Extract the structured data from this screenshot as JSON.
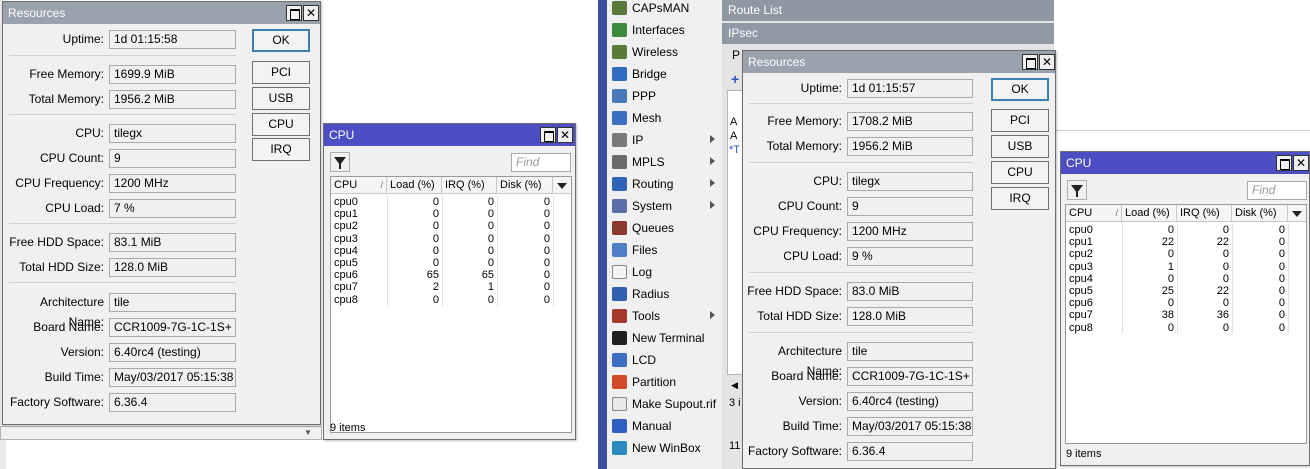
{
  "left": {
    "resources": {
      "title": "Resources",
      "fields": [
        {
          "label": "Uptime:",
          "value": "1d 01:15:58"
        },
        {
          "label": "Free Memory:",
          "value": "1699.9 MiB"
        },
        {
          "label": "Total Memory:",
          "value": "1956.2 MiB"
        },
        {
          "label": "CPU:",
          "value": "tilegx"
        },
        {
          "label": "CPU Count:",
          "value": "9"
        },
        {
          "label": "CPU Frequency:",
          "value": "1200 MHz"
        },
        {
          "label": "CPU Load:",
          "value": "7 %"
        },
        {
          "label": "Free HDD Space:",
          "value": "83.1 MiB"
        },
        {
          "label": "Total HDD Size:",
          "value": "128.0 MiB"
        },
        {
          "label": "Architecture Name:",
          "value": "tile"
        },
        {
          "label": "Board Name:",
          "value": "CCR1009-7G-1C-1S+"
        },
        {
          "label": "Version:",
          "value": "6.40rc4 (testing)"
        },
        {
          "label": "Build Time:",
          "value": "May/03/2017 05:15:38"
        },
        {
          "label": "Factory Software:",
          "value": "6.36.4"
        }
      ],
      "buttons": [
        "OK",
        "PCI",
        "USB",
        "CPU",
        "IRQ"
      ]
    },
    "cpu": {
      "title": "CPU",
      "find_placeholder": "Find",
      "columns": [
        "CPU",
        "Load (%)",
        "IRQ (%)",
        "Disk (%)"
      ],
      "rows": [
        [
          "cpu0",
          "0",
          "0",
          "0"
        ],
        [
          "cpu1",
          "0",
          "0",
          "0"
        ],
        [
          "cpu2",
          "0",
          "0",
          "0"
        ],
        [
          "cpu3",
          "0",
          "0",
          "0"
        ],
        [
          "cpu4",
          "0",
          "0",
          "0"
        ],
        [
          "cpu5",
          "0",
          "0",
          "0"
        ],
        [
          "cpu6",
          "65",
          "65",
          "0"
        ],
        [
          "cpu7",
          "2",
          "1",
          "0"
        ],
        [
          "cpu8",
          "0",
          "0",
          "0"
        ]
      ],
      "status": "9 items"
    }
  },
  "right": {
    "sidebar": [
      {
        "label": "CAPsMAN",
        "icon": "wifi-antenna-icon",
        "color": "#5b7a3a",
        "arrow": false
      },
      {
        "label": "Interfaces",
        "icon": "interfaces-icon",
        "color": "#3c8a3c",
        "arrow": false
      },
      {
        "label": "Wireless",
        "icon": "wireless-icon",
        "color": "#5b7a3a",
        "arrow": false
      },
      {
        "label": "Bridge",
        "icon": "bridge-icon",
        "color": "#2f6cc0",
        "arrow": false
      },
      {
        "label": "PPP",
        "icon": "ppp-icon",
        "color": "#4a78b8",
        "arrow": false
      },
      {
        "label": "Mesh",
        "icon": "mesh-icon",
        "color": "#3a6fc4",
        "arrow": false
      },
      {
        "label": "IP",
        "icon": "ip-icon",
        "color": "#7a7a7a",
        "arrow": true
      },
      {
        "label": "MPLS",
        "icon": "mpls-icon",
        "color": "#6b6b6b",
        "arrow": true
      },
      {
        "label": "Routing",
        "icon": "routing-icon",
        "color": "#2e63b5",
        "arrow": true
      },
      {
        "label": "System",
        "icon": "system-gear-icon",
        "color": "#5a6ea8",
        "arrow": true
      },
      {
        "label": "Queues",
        "icon": "queues-icon",
        "color": "#8a3a2a",
        "arrow": false
      },
      {
        "label": "Files",
        "icon": "files-folder-icon",
        "color": "#4d7fc8",
        "arrow": false
      },
      {
        "label": "Log",
        "icon": "log-icon",
        "color": "#f4f4f4",
        "arrow": false
      },
      {
        "label": "Radius",
        "icon": "radius-icon",
        "color": "#2f5fae",
        "arrow": false
      },
      {
        "label": "Tools",
        "icon": "tools-icon",
        "color": "#a43a2a",
        "arrow": true
      },
      {
        "label": "New Terminal",
        "icon": "terminal-icon",
        "color": "#202020",
        "arrow": false
      },
      {
        "label": "LCD",
        "icon": "lcd-icon",
        "color": "#3b6dc2",
        "arrow": false
      },
      {
        "label": "Partition",
        "icon": "partition-icon",
        "color": "#d24a2a",
        "arrow": false
      },
      {
        "label": "Make Supout.rif",
        "icon": "supout-icon",
        "color": "#e8e8e8",
        "arrow": false
      },
      {
        "label": "Manual",
        "icon": "manual-help-icon",
        "color": "#2f5fc0",
        "arrow": false
      },
      {
        "label": "New WinBox",
        "icon": "winbox-icon",
        "color": "#2a8ac0",
        "arrow": false
      }
    ],
    "route_list_title": "Route List",
    "ipsec_title": "IPsec",
    "ipsec_fragments": {
      "tab_partial": "P",
      "status_partial": "3 i",
      "row_a1": "A",
      "row_a2": "A",
      "row_t": "*T",
      "count_partial": "11"
    },
    "resources": {
      "title": "Resources",
      "fields": [
        {
          "label": "Uptime:",
          "value": "1d 01:15:57"
        },
        {
          "label": "Free Memory:",
          "value": "1708.2 MiB"
        },
        {
          "label": "Total Memory:",
          "value": "1956.2 MiB"
        },
        {
          "label": "CPU:",
          "value": "tilegx"
        },
        {
          "label": "CPU Count:",
          "value": "9"
        },
        {
          "label": "CPU Frequency:",
          "value": "1200 MHz"
        },
        {
          "label": "CPU Load:",
          "value": "9 %"
        },
        {
          "label": "Free HDD Space:",
          "value": "83.0 MiB"
        },
        {
          "label": "Total HDD Size:",
          "value": "128.0 MiB"
        },
        {
          "label": "Architecture Name:",
          "value": "tile"
        },
        {
          "label": "Board Name:",
          "value": "CCR1009-7G-1C-1S+"
        },
        {
          "label": "Version:",
          "value": "6.40rc4 (testing)"
        },
        {
          "label": "Build Time:",
          "value": "May/03/2017 05:15:38"
        },
        {
          "label": "Factory Software:",
          "value": "6.36.4"
        }
      ],
      "buttons": [
        "OK",
        "PCI",
        "USB",
        "CPU",
        "IRQ"
      ]
    },
    "cpu": {
      "title": "CPU",
      "find_placeholder": "Find",
      "columns": [
        "CPU",
        "Load (%)",
        "IRQ (%)",
        "Disk (%)"
      ],
      "rows": [
        [
          "cpu0",
          "0",
          "0",
          "0"
        ],
        [
          "cpu1",
          "22",
          "22",
          "0"
        ],
        [
          "cpu2",
          "0",
          "0",
          "0"
        ],
        [
          "cpu3",
          "1",
          "0",
          "0"
        ],
        [
          "cpu4",
          "0",
          "0",
          "0"
        ],
        [
          "cpu5",
          "25",
          "22",
          "0"
        ],
        [
          "cpu6",
          "0",
          "0",
          "0"
        ],
        [
          "cpu7",
          "38",
          "36",
          "0"
        ],
        [
          "cpu8",
          "0",
          "0",
          "0"
        ]
      ],
      "status": "9 items"
    }
  }
}
